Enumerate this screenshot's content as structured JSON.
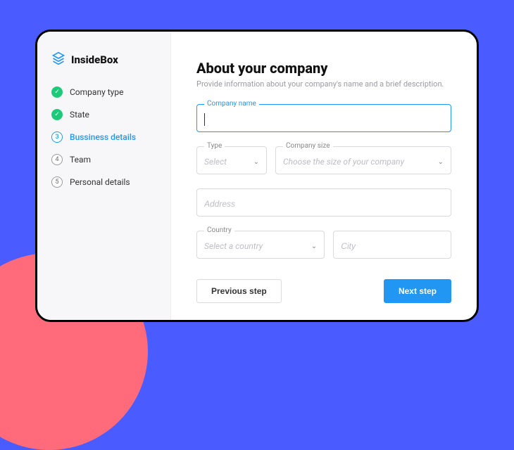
{
  "brand": {
    "name": "InsideBox"
  },
  "steps": [
    {
      "label": "Company type",
      "state": "done",
      "num": "✓"
    },
    {
      "label": "State",
      "state": "done",
      "num": "✓"
    },
    {
      "label": "Bussiness details",
      "state": "active",
      "num": "3"
    },
    {
      "label": "Team",
      "state": "pending",
      "num": "4"
    },
    {
      "label": "Personal details",
      "state": "pending",
      "num": "5"
    }
  ],
  "page": {
    "title": "About your company",
    "subtitle": "Provide information about your company's name and a brief description."
  },
  "form": {
    "company_name": {
      "label": "Company name",
      "value": ""
    },
    "type": {
      "label": "Type",
      "placeholder": "Select"
    },
    "company_size": {
      "label": "Company size",
      "placeholder": "Choose the size of your company"
    },
    "address": {
      "label": "",
      "placeholder": "Address"
    },
    "country": {
      "label": "Country",
      "placeholder": "Select a country"
    },
    "city": {
      "label": "",
      "placeholder": "City"
    }
  },
  "actions": {
    "prev": "Previous step",
    "next": "Next step"
  }
}
